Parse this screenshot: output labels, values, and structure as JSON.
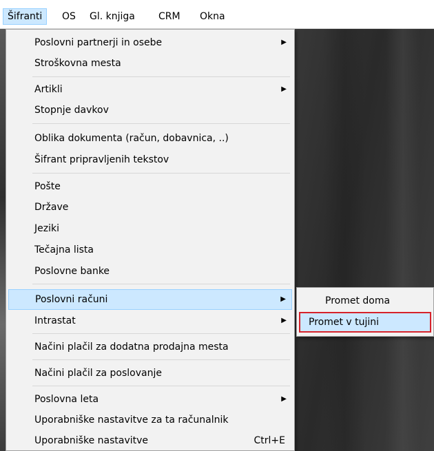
{
  "menubar": {
    "items": [
      {
        "label": "Šifranti",
        "active": true
      },
      {
        "label": "OS"
      },
      {
        "label": "Gl. knjiga"
      },
      {
        "label": "CRM"
      },
      {
        "label": "Okna"
      }
    ]
  },
  "dropdown": {
    "items": [
      {
        "label": "Poslovni partnerji in osebe",
        "submenu": true
      },
      {
        "label": "Stroškovna mesta"
      },
      {
        "label": "Artikli",
        "submenu": true
      },
      {
        "label": "Stopnje davkov"
      },
      {
        "label": "Oblika dokumenta (račun, dobavnica, ..)"
      },
      {
        "label": "Šifrant pripravljenih tekstov"
      },
      {
        "label": "Pošte"
      },
      {
        "label": "Države"
      },
      {
        "label": "Jeziki"
      },
      {
        "label": "Tečajna lista"
      },
      {
        "label": "Poslovne banke"
      },
      {
        "label": "Poslovni računi",
        "submenu": true,
        "highlighted": true
      },
      {
        "label": "Intrastat",
        "submenu": true
      },
      {
        "label": "Načini plačil za dodatna prodajna mesta"
      },
      {
        "label": "Načini plačil za poslovanje"
      },
      {
        "label": "Poslovna leta",
        "submenu": true
      },
      {
        "label": "Uporabniške nastavitve za ta računalnik"
      },
      {
        "label": "Uporabniške nastavitve",
        "shortcut": "Ctrl+E"
      }
    ],
    "submenu_arrow": "▶"
  },
  "submenu": {
    "items": [
      {
        "label": "Promet doma"
      },
      {
        "label": "Promet v tujini",
        "highlighted": true
      }
    ]
  },
  "colors": {
    "highlight": "#cce8ff",
    "highlight_border": "#99d1ff",
    "callout": "#d6222a"
  }
}
